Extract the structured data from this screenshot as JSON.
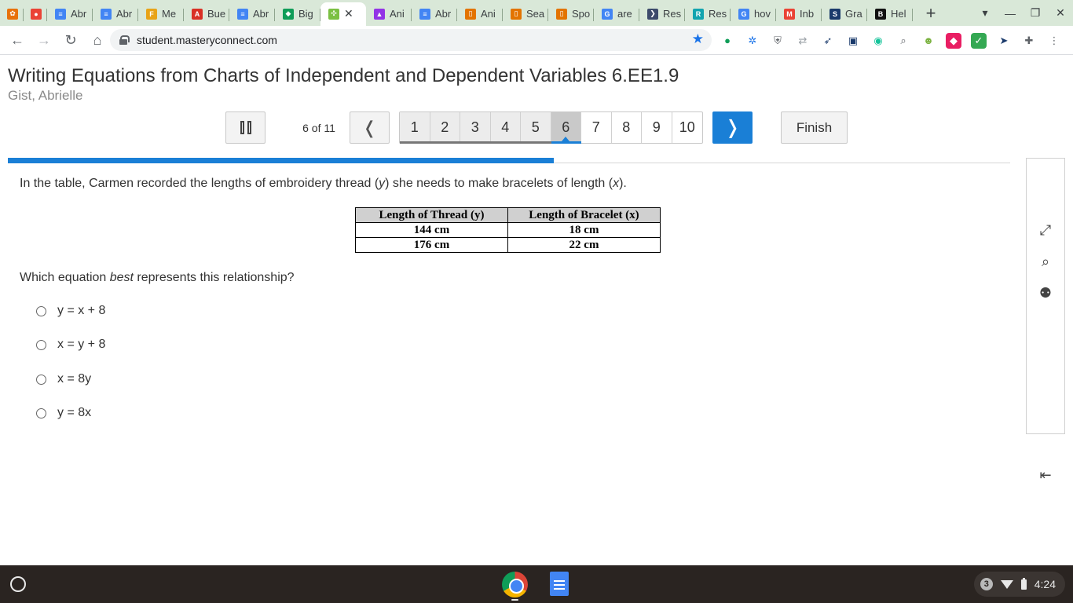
{
  "browser": {
    "tabs": [
      {
        "label": "",
        "icon": "colorful-logo-icon",
        "color": "#e8710a",
        "pinned": true
      },
      {
        "label": "",
        "icon": "record-icon",
        "color": "#ea4335",
        "pinned": true
      },
      {
        "label": "Abr",
        "icon": "docs-icon",
        "color": "#4285f4"
      },
      {
        "label": "Abr",
        "icon": "docs-icon",
        "color": "#4285f4"
      },
      {
        "label": "Me",
        "icon": "f-logo-icon",
        "color": "#e8a317"
      },
      {
        "label": "Bue",
        "icon": "adobe-icon",
        "color": "#d93025"
      },
      {
        "label": "Abr",
        "icon": "docs-icon",
        "color": "#4285f4"
      },
      {
        "label": "Big",
        "icon": "diamond-icon",
        "color": "#0f9d58"
      },
      {
        "label": "",
        "icon": "masteryconnect-icon",
        "color": "#7bc043",
        "active": true
      },
      {
        "label": "Ani",
        "icon": "classroom-icon",
        "color": "#9334e6"
      },
      {
        "label": "Abr",
        "icon": "docs-icon",
        "color": "#4285f4"
      },
      {
        "label": "Ani",
        "icon": "book-icon",
        "color": "#e37400"
      },
      {
        "label": "Sea",
        "icon": "book-icon",
        "color": "#e37400"
      },
      {
        "label": "Spo",
        "icon": "book-icon",
        "color": "#e37400"
      },
      {
        "label": "are",
        "icon": "google-icon",
        "color": "#4285f4"
      },
      {
        "label": "Res",
        "icon": "arrow-logo-icon",
        "color": "#3c4a6b"
      },
      {
        "label": "Res",
        "icon": "r-logo-icon",
        "color": "#12a4af"
      },
      {
        "label": "hov",
        "icon": "google-icon",
        "color": "#4285f4"
      },
      {
        "label": "Inb",
        "icon": "gmail-icon",
        "color": "#ea4335"
      },
      {
        "label": "Gra",
        "icon": "sis-icon",
        "color": "#1a3a6b"
      },
      {
        "label": "Hel",
        "icon": "b-logo-icon",
        "color": "#111111"
      }
    ],
    "url": "student.masteryconnect.com"
  },
  "assessment": {
    "title": "Writing Equations from Charts of Independent and Dependent Variables 6.EE1.9",
    "student": "Gist, Abrielle",
    "counter": "6 of 11",
    "pages": [
      "1",
      "2",
      "3",
      "4",
      "5",
      "6",
      "7",
      "8",
      "9",
      "10"
    ],
    "current_page": 6,
    "finish_label": "Finish",
    "progress": 0.545
  },
  "question": {
    "text_before_y": "In the table, Carmen recorded the lengths of embroidery thread (",
    "var_y": "y",
    "text_between": ") she needs to make bracelets of length (",
    "var_x": "x",
    "text_after": ").",
    "table": {
      "headers": [
        "Length of Thread (y)",
        "Length of Bracelet (x)"
      ],
      "rows": [
        [
          "144 cm",
          "18 cm"
        ],
        [
          "176 cm",
          "22 cm"
        ]
      ]
    },
    "prompt_before": "Which equation ",
    "prompt_emphasis": "best",
    "prompt_after": "  represents this relationship?",
    "choices": [
      "y = x + 8",
      "x = y + 8",
      "x = 8y",
      "y = 8x"
    ]
  },
  "tray": {
    "notification_count": "3",
    "time": "4:24"
  }
}
